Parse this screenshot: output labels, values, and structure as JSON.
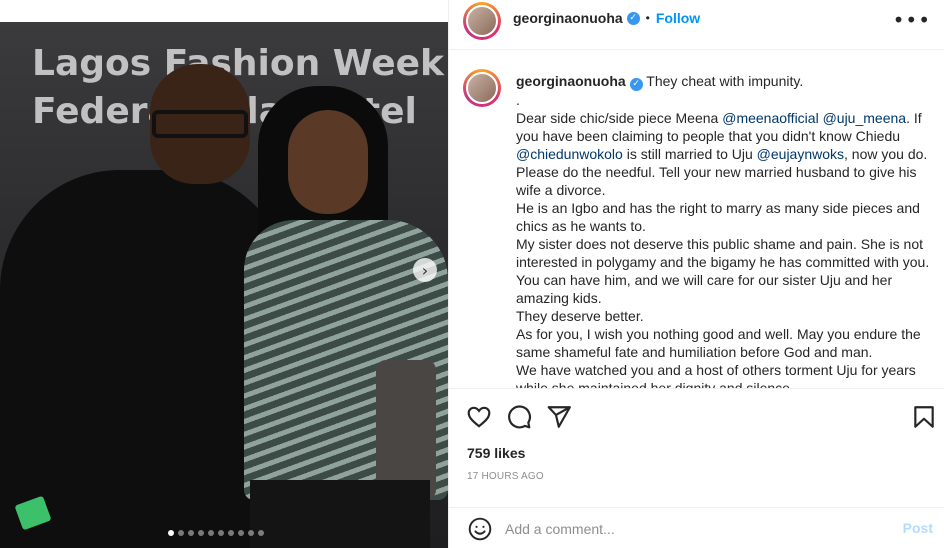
{
  "post": {
    "username": "georginaonuoha",
    "follow_label": "Follow",
    "separator": "•",
    "more_label": "•••",
    "image_banner_text": "Lagos Fashion Week T\nFederal Pala  Hotel",
    "carousel": {
      "count": 10,
      "active_index": 0
    }
  },
  "caption": {
    "lines": [
      [
        {
          "t": "georginaonuoha",
          "k": "user"
        },
        {
          "t": " They cheat with impunity.",
          "k": "text"
        }
      ],
      [
        {
          "t": ".",
          "k": "text"
        }
      ],
      [
        {
          "t": "Dear side chic/side piece Meena ",
          "k": "text"
        },
        {
          "t": "@meenaofficial",
          "k": "mention"
        },
        {
          "t": " ",
          "k": "text"
        },
        {
          "t": "@uju_meena",
          "k": "mention"
        },
        {
          "t": ". If",
          "k": "text"
        }
      ],
      [
        {
          "t": "you have been claiming to people that you didn't know Chiedu",
          "k": "text"
        }
      ],
      [
        {
          "t": "@chiedunwokolo",
          "k": "mention"
        },
        {
          "t": " is still married to Uju ",
          "k": "text"
        },
        {
          "t": "@eujaynwoks",
          "k": "mention"
        },
        {
          "t": ", now you do.",
          "k": "text"
        }
      ],
      [
        {
          "t": "Please do the needful. Tell your new married husband to give his",
          "k": "text"
        }
      ],
      [
        {
          "t": "wife a divorce.",
          "k": "text"
        }
      ],
      [
        {
          "t": "He is an Igbo and has the right to marry as many side pieces and",
          "k": "text"
        }
      ],
      [
        {
          "t": "chics as he wants to.",
          "k": "text"
        }
      ],
      [
        {
          "t": "My sister does not deserve this public shame and pain. She is not",
          "k": "text"
        }
      ],
      [
        {
          "t": "interested in polygamy and the bigamy he has committed with you.",
          "k": "text"
        }
      ],
      [
        {
          "t": "You can have him, and we will care for our sister Uju and her",
          "k": "text"
        }
      ],
      [
        {
          "t": "amazing kids.",
          "k": "text"
        }
      ],
      [
        {
          "t": "They deserve better.",
          "k": "text"
        }
      ],
      [
        {
          "t": "As for you, I wish you nothing good and well. May you endure the",
          "k": "text"
        }
      ],
      [
        {
          "t": "same shameful fate and humiliation before God and man.",
          "k": "text"
        }
      ],
      [
        {
          "t": "We have watched you and a host of others torment Uju for years",
          "k": "text"
        }
      ],
      [
        {
          "t": "while she maintained her dignity and silence.",
          "k": "text"
        }
      ]
    ]
  },
  "stats": {
    "likes": "759 likes",
    "time": "17 HOURS AGO"
  },
  "comment": {
    "placeholder": "Add a comment...",
    "post_label": "Post"
  },
  "colors": {
    "link": "#0095f6",
    "mention": "#00376b",
    "post_disabled": "#b3dbff",
    "verified": "#3897f0"
  },
  "icons": {
    "like": "heart-icon",
    "comment": "comment-icon",
    "share": "paper-plane-icon",
    "save": "bookmark-icon",
    "emoji": "smiley-icon",
    "verified": "verified-badge-icon",
    "next": "chevron-right-icon",
    "more": "more-options-icon"
  }
}
